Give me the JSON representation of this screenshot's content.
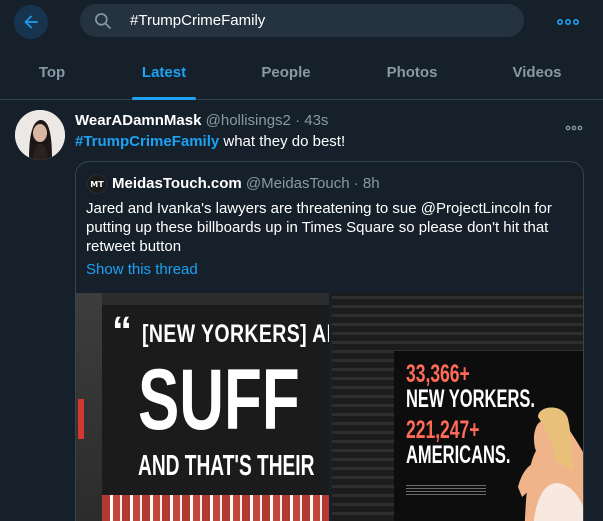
{
  "search": {
    "query": "#TrumpCrimeFamily"
  },
  "tabs": [
    {
      "label": "Top",
      "active": false
    },
    {
      "label": "Latest",
      "active": true
    },
    {
      "label": "People",
      "active": false
    },
    {
      "label": "Photos",
      "active": false
    },
    {
      "label": "Videos",
      "active": false
    }
  ],
  "tweet": {
    "name": "WearADamnMask",
    "handle": "@hollisings2",
    "dot": "·",
    "time": "43s",
    "hashtag": "#TrumpCrimeFamily",
    "text_rest": " what they do best!",
    "quote": {
      "avatar_initials": "MT",
      "name": "MeidasTouch.com",
      "handle": "@MeidasTouch",
      "dot": "·",
      "time": "8h",
      "text": "Jared and Ivanka's lawyers are threatening to sue @ProjectLincoln for putting up these billboards up in Times Square so please don't hit that retweet button",
      "show_thread": "Show this thread",
      "image_left": {
        "open_quote": "“",
        "line1": "[NEW YORKERS] ARE",
        "line2": "SUFF",
        "line3": "AND THAT'S THEIR"
      },
      "image_right": {
        "line1": "33,366+",
        "line2": "NEW YORKERS.",
        "line3": "221,247+",
        "line4": "AMERICANS."
      }
    }
  },
  "colors": {
    "background": "#15202b",
    "accent": "#1da1f2",
    "muted": "#8899a6",
    "border": "#38444d"
  },
  "icons": {
    "back": "arrow-left-icon",
    "search": "search-icon",
    "more": "more-horizontal-icon"
  }
}
